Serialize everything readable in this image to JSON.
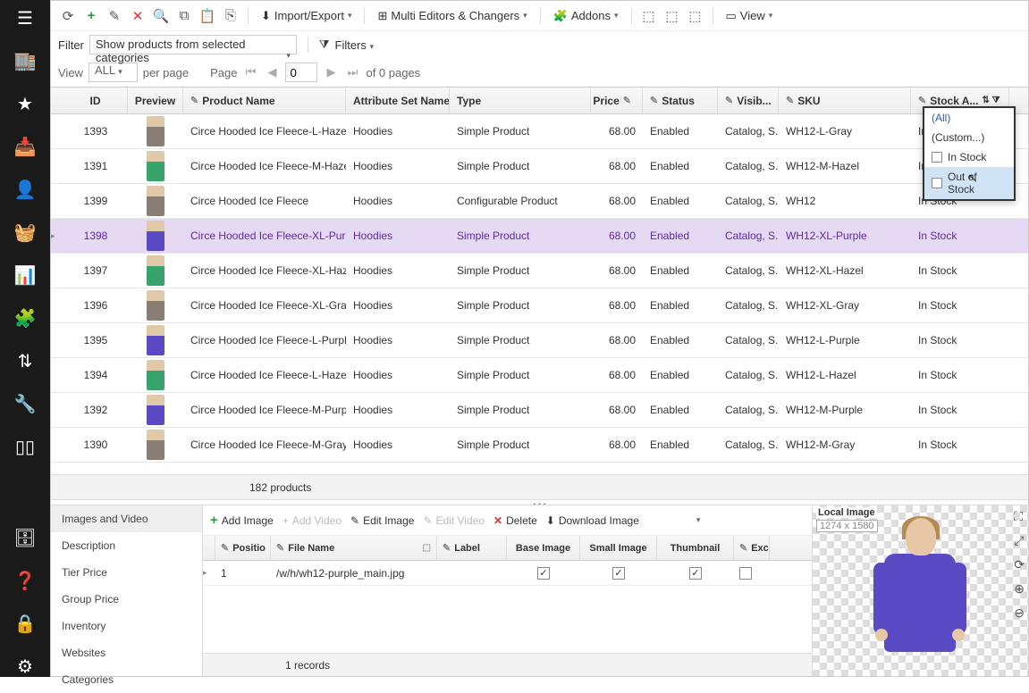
{
  "toolbar": {
    "import_export": "Import/Export",
    "multi_editors": "Multi Editors & Changers",
    "addons": "Addons",
    "view": "View"
  },
  "filter": {
    "label": "Filter",
    "selected": "Show products from selected categories",
    "filters_label": "Filters"
  },
  "pager": {
    "view_label": "View",
    "view_value": "ALL",
    "per_page": "per page",
    "page_label": "Page",
    "page_value": "0",
    "of_pages": "of 0 pages"
  },
  "columns": {
    "id": "ID",
    "preview": "Preview",
    "product_name": "Product Name",
    "attribute_set": "Attribute Set Name",
    "type": "Type",
    "price": "Price",
    "status": "Status",
    "visib": "Visib...",
    "sku": "SKU",
    "stock": "Stock A..."
  },
  "rows": [
    {
      "id": "1393",
      "name": "Circe Hooded Ice Fleece-L-Hazel",
      "attr": "Hoodies",
      "type": "Simple Product",
      "price": "68.00",
      "status": "Enabled",
      "visib": "Catalog, S...",
      "sku": "WH12-L-Gray",
      "stock": "In Stock",
      "tc": "#8a7d74"
    },
    {
      "id": "1391",
      "name": "Circe Hooded Ice Fleece-M-Hazel",
      "attr": "Hoodies",
      "type": "Simple Product",
      "price": "68.00",
      "status": "Enabled",
      "visib": "Catalog, S...",
      "sku": "WH12-M-Hazel",
      "stock": "In Stock",
      "tc": "#3aa36b"
    },
    {
      "id": "1399",
      "name": "Circe Hooded Ice Fleece",
      "attr": "Hoodies",
      "type": "Configurable Product",
      "price": "68.00",
      "status": "Enabled",
      "visib": "Catalog, S...",
      "sku": "WH12",
      "stock": "In Stock",
      "tc": "#8a7d74"
    },
    {
      "id": "1398",
      "name": "Circe Hooded Ice Fleece-XL-Purple",
      "attr": "Hoodies",
      "type": "Simple Product",
      "price": "68.00",
      "status": "Enabled",
      "visib": "Catalog, S...",
      "sku": "WH12-XL-Purple",
      "stock": "In Stock",
      "tc": "#5a4bc4",
      "sel": true
    },
    {
      "id": "1397",
      "name": "Circe Hooded Ice Fleece-XL-Hazel",
      "attr": "Hoodies",
      "type": "Simple Product",
      "price": "68.00",
      "status": "Enabled",
      "visib": "Catalog, S...",
      "sku": "WH12-XL-Hazel",
      "stock": "In Stock",
      "tc": "#3aa36b"
    },
    {
      "id": "1396",
      "name": "Circe Hooded Ice Fleece-XL-Gray",
      "attr": "Hoodies",
      "type": "Simple Product",
      "price": "68.00",
      "status": "Enabled",
      "visib": "Catalog, S...",
      "sku": "WH12-XL-Gray",
      "stock": "In Stock",
      "tc": "#8a7d74"
    },
    {
      "id": "1395",
      "name": "Circe Hooded Ice Fleece-L-Purple",
      "attr": "Hoodies",
      "type": "Simple Product",
      "price": "68.00",
      "status": "Enabled",
      "visib": "Catalog, S...",
      "sku": "WH12-L-Purple",
      "stock": "In Stock",
      "tc": "#5a4bc4"
    },
    {
      "id": "1394",
      "name": "Circe Hooded Ice Fleece-L-Hazel",
      "attr": "Hoodies",
      "type": "Simple Product",
      "price": "68.00",
      "status": "Enabled",
      "visib": "Catalog, S...",
      "sku": "WH12-L-Hazel",
      "stock": "In Stock",
      "tc": "#3aa36b"
    },
    {
      "id": "1392",
      "name": "Circe Hooded Ice Fleece-M-Purple",
      "attr": "Hoodies",
      "type": "Simple Product",
      "price": "68.00",
      "status": "Enabled",
      "visib": "Catalog, S...",
      "sku": "WH12-M-Purple",
      "stock": "In Stock",
      "tc": "#5a4bc4"
    },
    {
      "id": "1390",
      "name": "Circe Hooded Ice Fleece-M-Gray",
      "attr": "Hoodies",
      "type": "Simple Product",
      "price": "68.00",
      "status": "Enabled",
      "visib": "Catalog, S...",
      "sku": "WH12-M-Gray",
      "stock": "In Stock",
      "tc": "#8a7d74"
    }
  ],
  "grid_footer": "182 products",
  "filter_popup": {
    "all": "(All)",
    "custom": "(Custom...)",
    "in_stock": "In Stock",
    "out_of_stock": "Out of Stock"
  },
  "tabs": [
    "Images and Video",
    "Description",
    "Tier Price",
    "Group Price",
    "Inventory",
    "Websites",
    "Categories"
  ],
  "detail_toolbar": {
    "add_image": "Add Image",
    "add_video": "Add Video",
    "edit_image": "Edit Image",
    "edit_video": "Edit Video",
    "delete": "Delete",
    "download_image": "Download Image"
  },
  "detail_cols": {
    "position": "Positio",
    "file_name": "File Name",
    "label": "Label",
    "base": "Base Image",
    "small": "Small Image",
    "thumb": "Thumbnail",
    "exc": "Exc"
  },
  "detail_row": {
    "position": "1",
    "file_name": "/w/h/wh12-purple_main.jpg",
    "base": true,
    "small": true,
    "thumb": true,
    "exc": false
  },
  "detail_footer": "1 records",
  "preview": {
    "label": "Local Image",
    "dim": "1274 x 1580"
  }
}
